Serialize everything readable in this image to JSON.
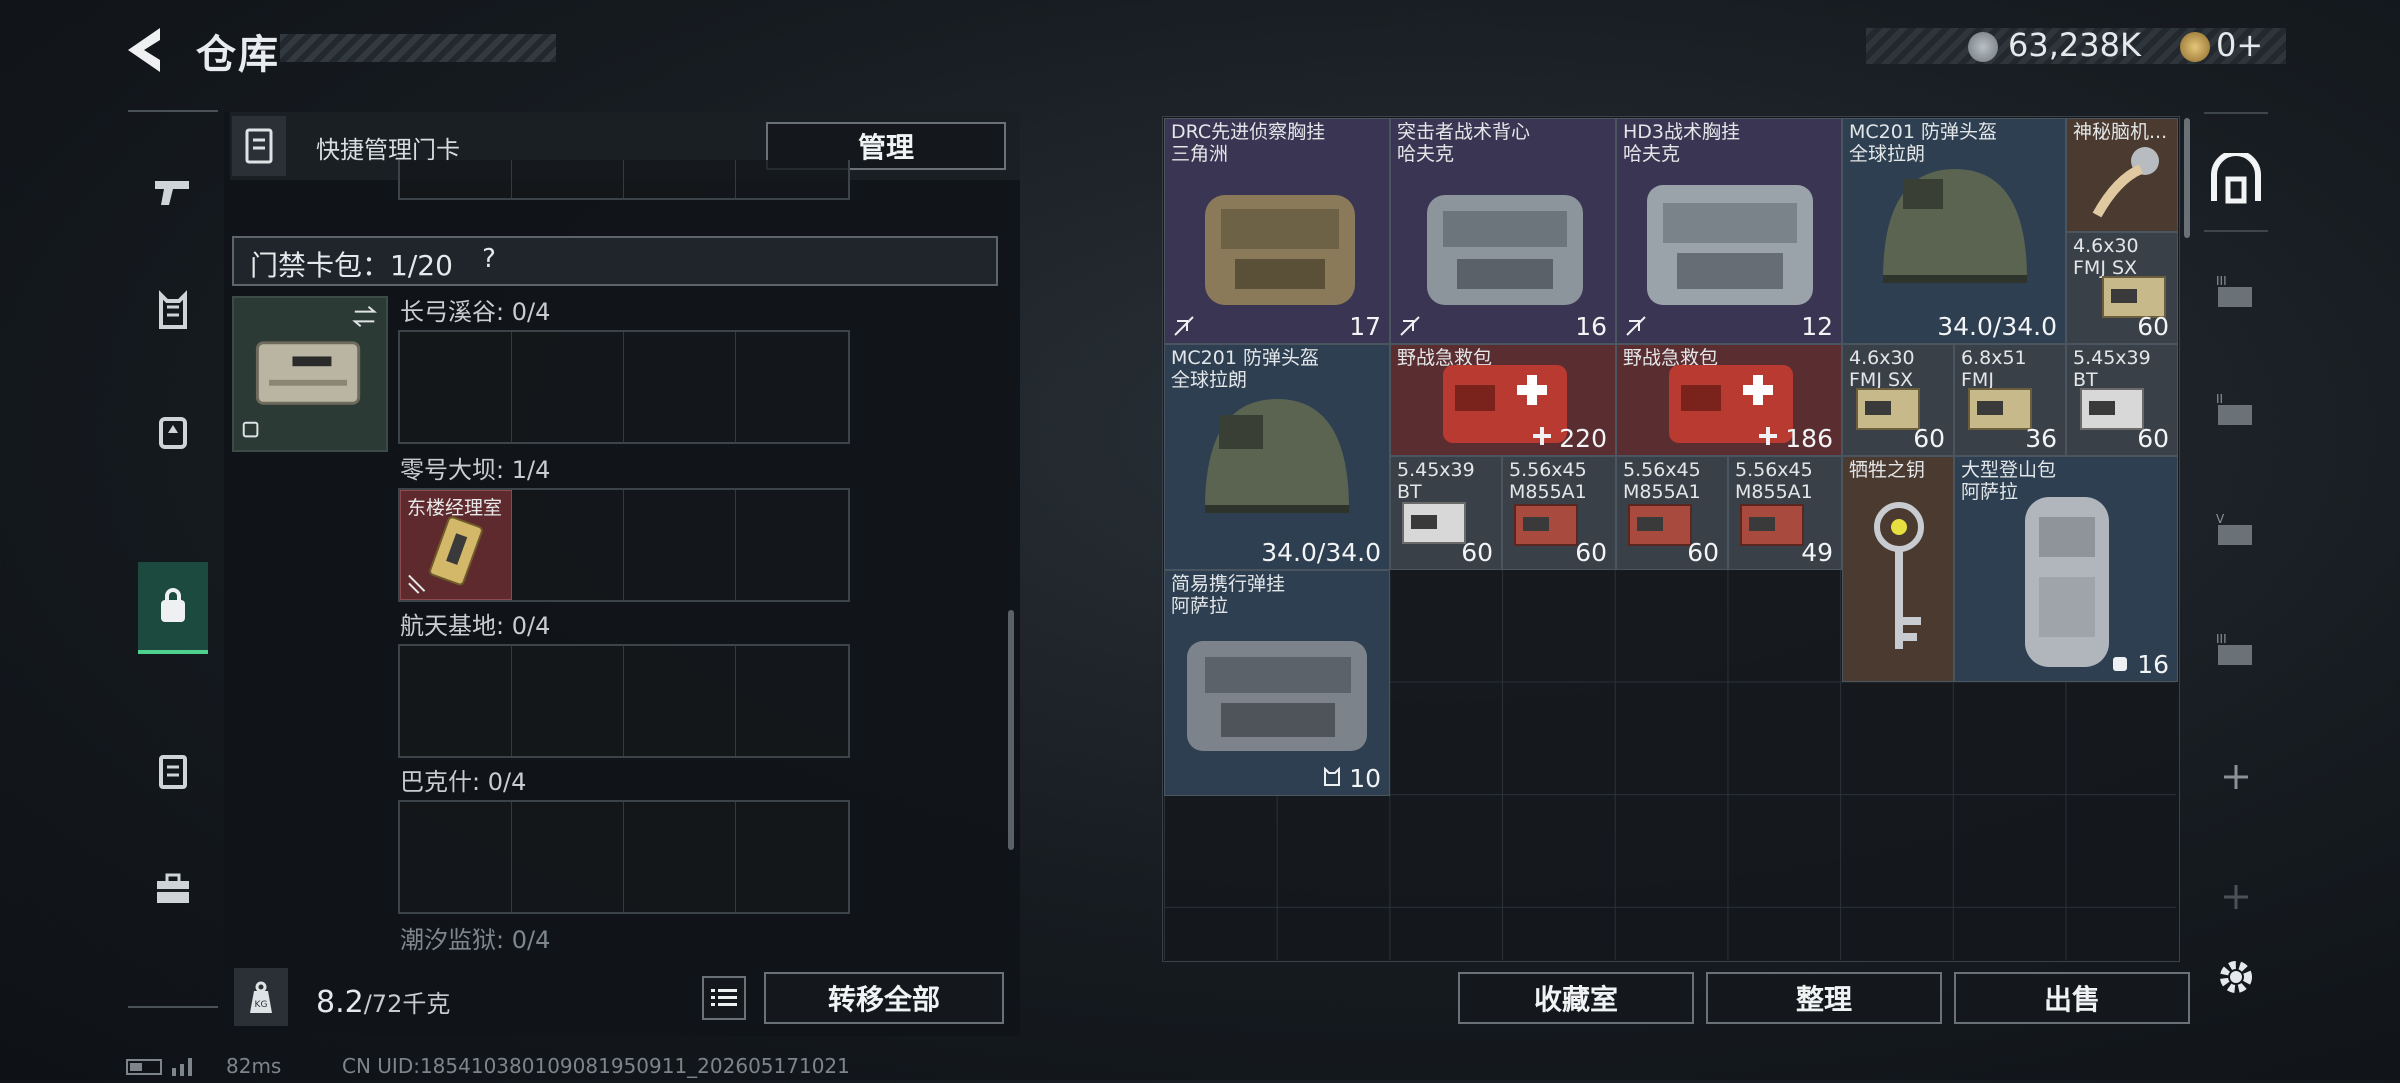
{
  "header": {
    "title": "仓库",
    "currency": {
      "amount1": "63,238K",
      "amount2": "0+"
    }
  },
  "left_panel": {
    "quick_card_label": "快捷管理门卡",
    "manage_button": "管理",
    "card_pack_label": "门禁卡包：1/20",
    "card_pack_help": "?",
    "sections": [
      {
        "label": "长弓溪谷: 0/4"
      },
      {
        "label": "零号大坝: 1/4",
        "card_name": "东楼经理室"
      },
      {
        "label": "航天基地: 0/4"
      },
      {
        "label": "巴克什: 0/4"
      },
      {
        "label": "潮汐监狱: 0/4"
      }
    ],
    "weight_value": "8.2",
    "weight_max": "/72千克",
    "transfer_all_button": "转移全部"
  },
  "footer": {
    "ping": "82ms",
    "uid": "CN UID:18541038010908195091​1_202605171021"
  },
  "inventory": {
    "items": [
      {
        "name1": "DRC先进侦察胸挂",
        "name2": "三角洲",
        "qty": "17"
      },
      {
        "name1": "突击者战术背心",
        "name2": "哈夫克",
        "qty": "16"
      },
      {
        "name1": "HD3战术胸挂",
        "name2": "哈夫克",
        "qty": "12"
      },
      {
        "name1": "MC201 防弹头盔",
        "name2": "全球拉朗",
        "dur": "34.0/34.0"
      },
      {
        "name1": "神秘脑机...",
        "name2": ""
      },
      {
        "name1": "4.6x30",
        "name2": "FMJ SX",
        "qty": "60"
      },
      {
        "name1": "MC201 防弹头盔",
        "name2": "全球拉朗",
        "dur": "34.0/34.0"
      },
      {
        "name1": "野战急救包",
        "name2": "",
        "qty": "220"
      },
      {
        "name1": "野战急救包",
        "name2": "",
        "qty": "186"
      },
      {
        "name1": "4.6x30",
        "name2": "FMJ SX",
        "qty": "60"
      },
      {
        "name1": "6.8x51",
        "name2": "FMJ",
        "qty": "36"
      },
      {
        "name1": "5.45x39",
        "name2": "BT",
        "qty": "60"
      },
      {
        "name1": "5.45x39",
        "name2": "BT",
        "qty": "60"
      },
      {
        "name1": "5.56x45",
        "name2": "M855A1",
        "qty": "60"
      },
      {
        "name1": "5.56x45",
        "name2": "M855A1",
        "qty": "60"
      },
      {
        "name1": "5.56x45",
        "name2": "M855A1",
        "qty": "49"
      },
      {
        "name1": "牺牲之钥",
        "name2": ""
      },
      {
        "name1": "大型登山包",
        "name2": "阿萨拉",
        "qty": "16"
      },
      {
        "name1": "简易携行弹挂",
        "name2": "阿萨拉",
        "qty": "10"
      }
    ],
    "buttons": {
      "collection": "收藏室",
      "sort": "整理",
      "sell": "出售"
    }
  }
}
